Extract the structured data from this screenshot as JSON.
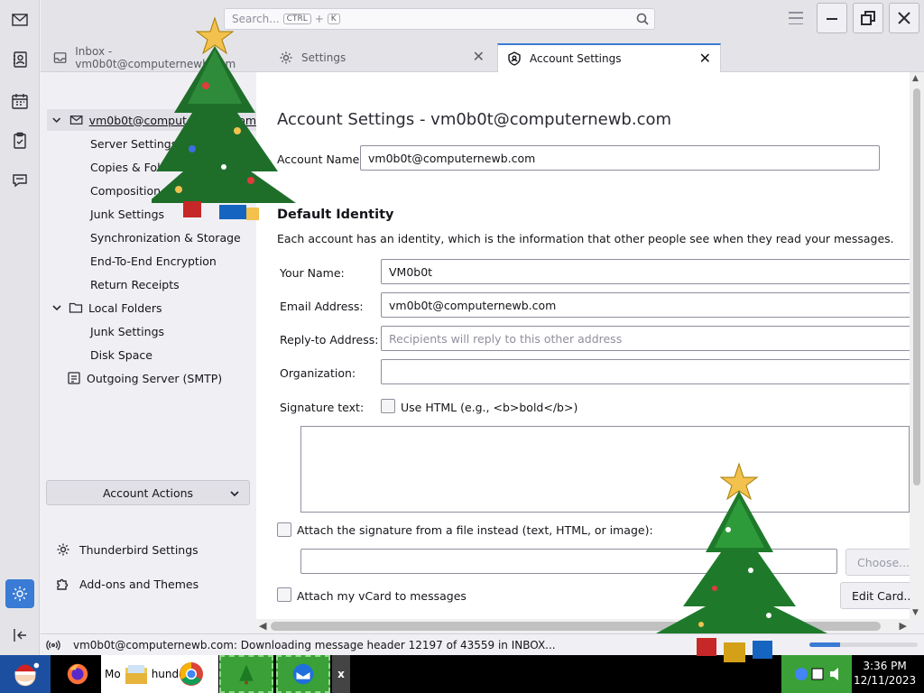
{
  "spaces": {
    "items": [
      "mail-icon",
      "address-book-icon",
      "calendar-icon",
      "tasks-icon",
      "chat-icon",
      "settings-icon",
      "collapse-icon"
    ]
  },
  "titlebar": {
    "search_placeholder": "Search...",
    "search_key1": "CTRL",
    "search_plus": "+",
    "search_key2": "K"
  },
  "tabs": [
    {
      "label": "Inbox - vm0b0t@computernewb.com",
      "icon": "inbox-icon"
    },
    {
      "label": "Settings",
      "icon": "gear-icon"
    },
    {
      "label": "Account Settings",
      "icon": "account-settings-icon"
    }
  ],
  "tree": {
    "account": "vm0b0t@computernewb.com",
    "account_items": [
      "Server Settings",
      "Copies & Folders",
      "Composition & Addressing",
      "Junk Settings",
      "Synchronization & Storage",
      "End-To-End Encryption",
      "Return Receipts"
    ],
    "local_folders": "Local Folders",
    "local_items": [
      "Junk Settings",
      "Disk Space"
    ],
    "smtp": "Outgoing Server (SMTP)",
    "account_actions": "Account Actions",
    "thunderbird_settings": "Thunderbird Settings",
    "addons": "Add-ons and Themes"
  },
  "main": {
    "title": "Account Settings - vm0b0t@computernewb.com",
    "account_name_label": "Account Name:",
    "account_name_value": "vm0b0t@computernewb.com",
    "default_identity": "Default Identity",
    "identity_desc": "Each account has an identity, which is the information that other people see when they read your messages.",
    "your_name_label": "Your Name:",
    "your_name_value": "VM0b0t",
    "email_label": "Email Address:",
    "email_value": "vm0b0t@computernewb.com",
    "reply_to_label": "Reply-to Address:",
    "reply_to_placeholder": "Recipients will reply to this other address",
    "org_label": "Organization:",
    "org_value": "",
    "signature_label": "Signature text:",
    "use_html_label": "Use HTML (e.g., <b>bold</b>)",
    "attach_sig_label": "Attach the signature from a file instead (text, HTML, or image):",
    "choose_button": "Choose...",
    "attach_vcard_label": "Attach my vCard to messages",
    "edit_card_button": "Edit Card..."
  },
  "status": {
    "text": "vm0b0t@computernewb.com: Downloading message header 12197 of 43559 in INBOX...",
    "progress_fraction": 0.28
  },
  "taskbar": {
    "tasks": [
      "Mo",
      "hunde"
    ],
    "close_glyph": "x",
    "time": "3:36 PM",
    "date": "12/11/2023"
  },
  "colors": {
    "accent": "#3a7bd5"
  }
}
